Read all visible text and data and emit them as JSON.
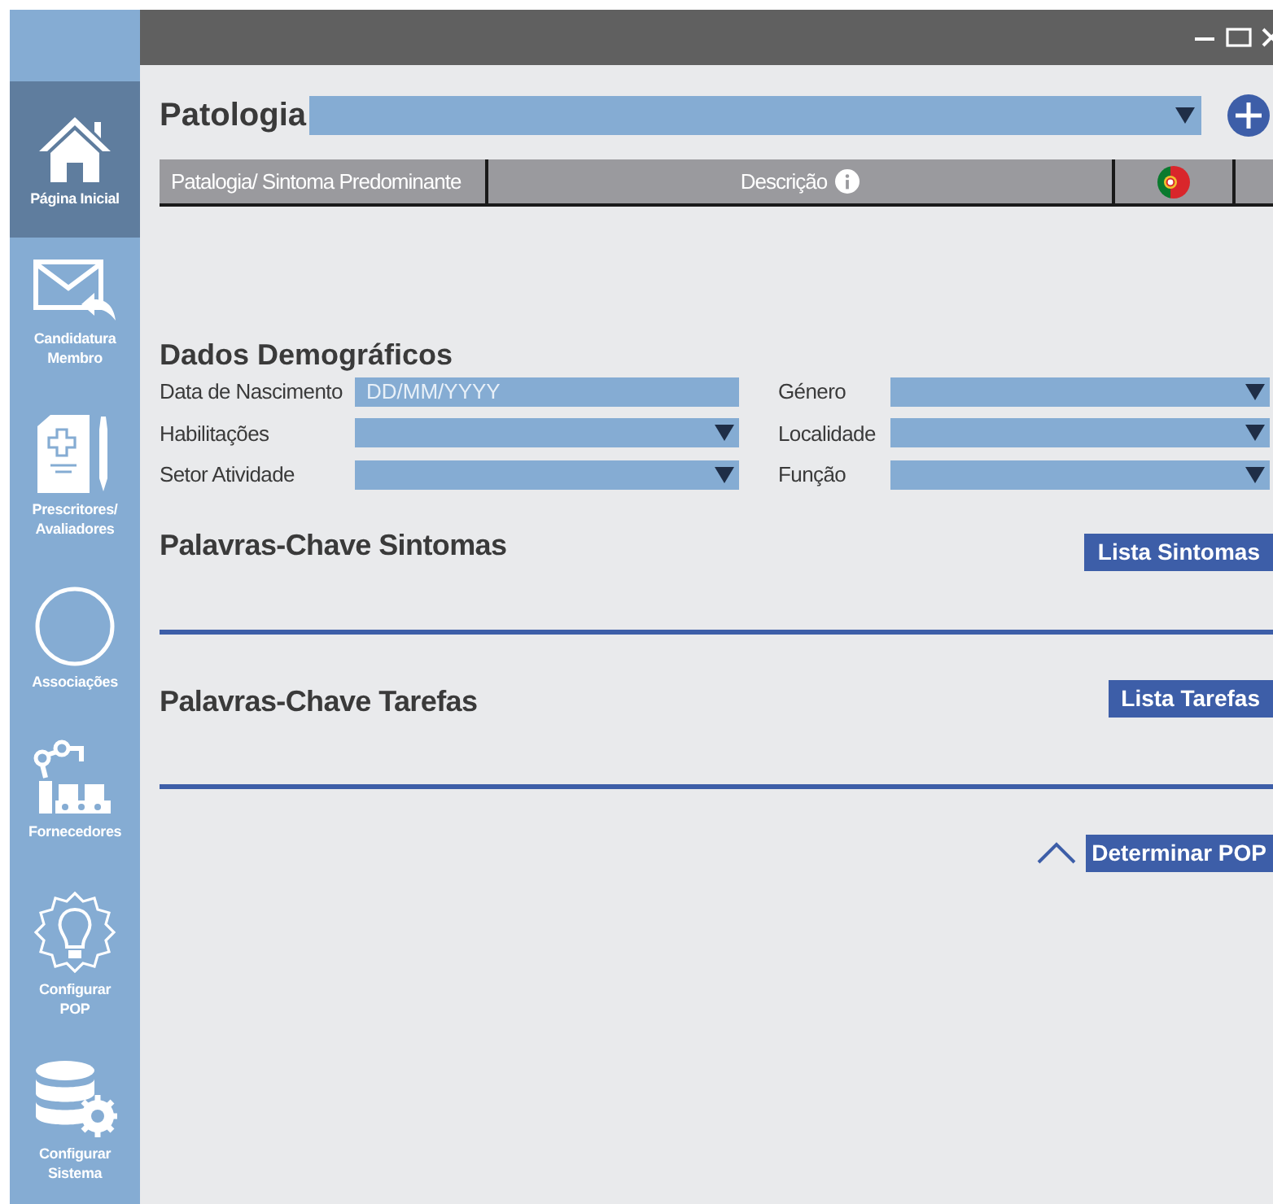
{
  "sidebar": {
    "items": [
      {
        "kind": "home",
        "label": "Página Inicial",
        "selected": true
      },
      {
        "kind": "mail",
        "label": "Candidatura Membro",
        "selected": false
      },
      {
        "kind": "prescription",
        "label": "Prescritores/ Avaliadores",
        "selected": false
      },
      {
        "kind": "circle",
        "label": "Associações",
        "selected": false
      },
      {
        "kind": "robot",
        "label": "Fornecedores",
        "selected": false
      },
      {
        "kind": "bulb",
        "label": "Configurar POP",
        "selected": false
      },
      {
        "kind": "database",
        "label": "Configurar Sistema",
        "selected": false
      }
    ]
  },
  "patologia": {
    "label": "Patologia"
  },
  "table": {
    "columns": [
      {
        "kind": "text",
        "label": "Patalogia/ Sintoma Predominante"
      },
      {
        "kind": "info",
        "label": "Descrição"
      },
      {
        "kind": "flag"
      },
      {
        "kind": "blank"
      }
    ]
  },
  "demographics": {
    "title": "Dados Demográficos",
    "fields": [
      {
        "kind": "text",
        "label": "Data de Nascimento",
        "placeholder": "DD/MM/YYYY"
      },
      {
        "kind": "dropdown",
        "label": "Género"
      },
      {
        "kind": "dropdown",
        "label": "Habilitações"
      },
      {
        "kind": "dropdown",
        "label": "Localidade"
      },
      {
        "kind": "dropdown",
        "label": "Setor Atividade"
      },
      {
        "kind": "dropdown",
        "label": "Função"
      }
    ]
  },
  "sections": [
    {
      "title": "Palavras-Chave Sintomas",
      "button": "Lista Sintomas"
    },
    {
      "title": "Palavras-Chave Tarefas",
      "button": "Lista Tarefas"
    }
  ],
  "action_button": "Determinar POP"
}
